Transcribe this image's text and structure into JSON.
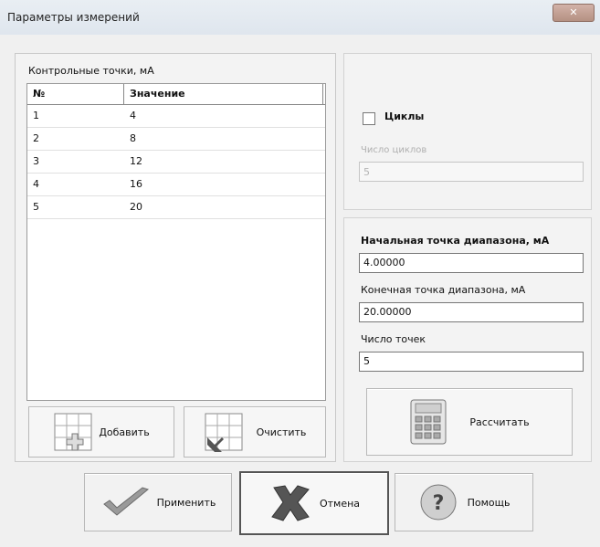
{
  "window": {
    "title": "Параметры измерений"
  },
  "control_points": {
    "label": "Контрольные точки, мА",
    "columns": [
      "№",
      "Значение"
    ],
    "rows": [
      {
        "no": "1",
        "value": "4"
      },
      {
        "no": "2",
        "value": "8"
      },
      {
        "no": "3",
        "value": "12"
      },
      {
        "no": "4",
        "value": "16"
      },
      {
        "no": "5",
        "value": "20"
      }
    ],
    "add_button": "Добавить",
    "clear_button": "Очистить"
  },
  "cycles": {
    "checkbox_label": "Циклы",
    "count_label": "Число циклов",
    "count_value": "5"
  },
  "range": {
    "start_label": "Начальная точка диапазона, мА",
    "start_value": "4.00000",
    "end_label": "Конечная точка диапазона, мА",
    "end_value": "20.00000",
    "points_label": "Число точек",
    "points_value": "5",
    "calc_button": "Рассчитать"
  },
  "footer": {
    "apply": "Применить",
    "cancel": "Отмена",
    "help": "Помощь"
  },
  "icons": {
    "close": "close-icon",
    "add": "grid-plus-icon",
    "clear": "grid-x-icon",
    "calc": "calculator-icon",
    "apply": "checkmark-icon",
    "cancel": "cross-icon",
    "help": "help-icon"
  }
}
